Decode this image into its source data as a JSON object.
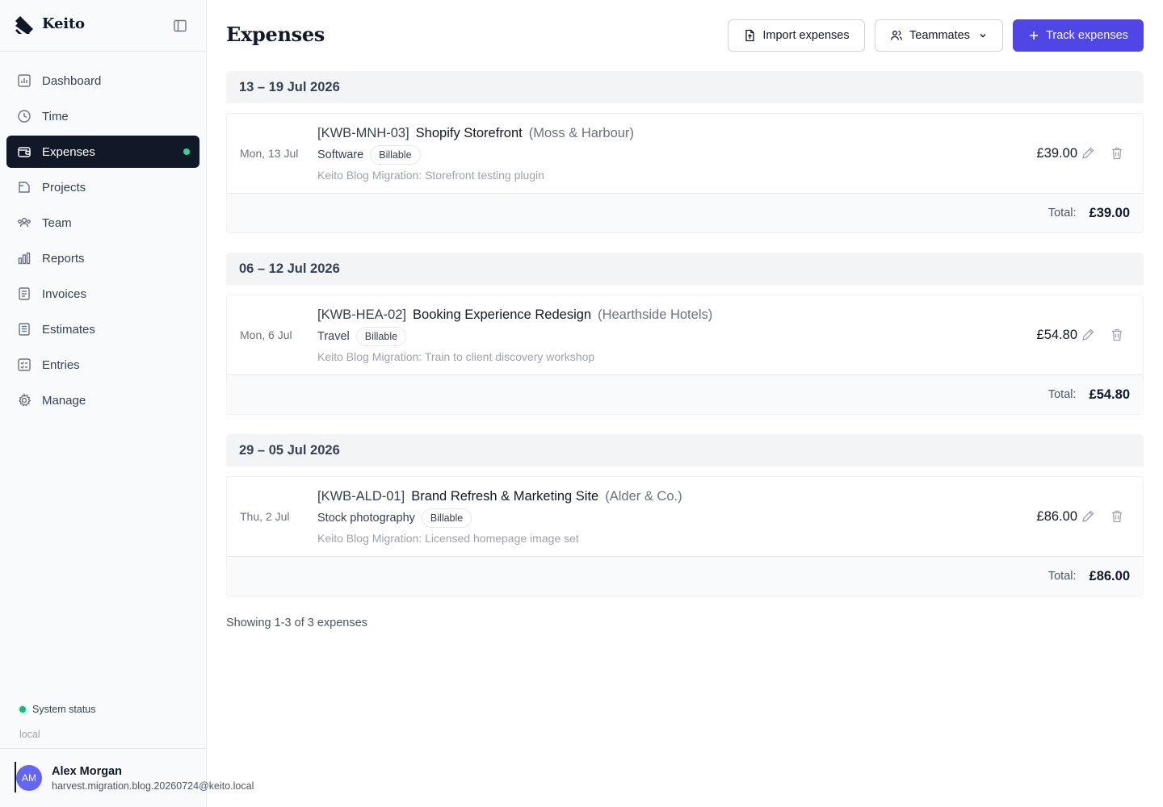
{
  "app": {
    "name": "Keito"
  },
  "sidebar": {
    "items": [
      {
        "label": "Dashboard",
        "icon": "dashboard-icon"
      },
      {
        "label": "Time",
        "icon": "clock-icon"
      },
      {
        "label": "Expenses",
        "icon": "wallet-icon",
        "active": true
      },
      {
        "label": "Projects",
        "icon": "folder-icon"
      },
      {
        "label": "Team",
        "icon": "users-icon"
      },
      {
        "label": "Reports",
        "icon": "bar-chart-icon"
      },
      {
        "label": "Invoices",
        "icon": "invoice-icon"
      },
      {
        "label": "Estimates",
        "icon": "estimate-icon"
      },
      {
        "label": "Entries",
        "icon": "checklist-icon"
      },
      {
        "label": "Manage",
        "icon": "gear-icon"
      }
    ],
    "status_label": "System status",
    "environment": "local"
  },
  "user": {
    "initials": "AM",
    "name": "Alex Morgan",
    "email": "harvest.migration.blog.20260724@keito.local"
  },
  "header": {
    "title": "Expenses",
    "import_label": "Import expenses",
    "teammates_label": "Teammates",
    "track_label": "Track expenses"
  },
  "groups": [
    {
      "range": "13 – 19 Jul 2026",
      "entries": [
        {
          "date": "Mon, 13 Jul",
          "code": "[KWB-MNH-03]",
          "project": "Shopify Storefront",
          "client": "(Moss & Harbour)",
          "category": "Software",
          "badge": "Billable",
          "notes": "Keito Blog Migration: Storefront testing plugin",
          "amount": "£39.00"
        }
      ],
      "total_label": "Total:",
      "total": "£39.00"
    },
    {
      "range": "06 – 12 Jul 2026",
      "entries": [
        {
          "date": "Mon, 6 Jul",
          "code": "[KWB-HEA-02]",
          "project": "Booking Experience Redesign",
          "client": "(Hearthside Hotels)",
          "category": "Travel",
          "badge": "Billable",
          "notes": "Keito Blog Migration: Train to client discovery workshop",
          "amount": "£54.80"
        }
      ],
      "total_label": "Total:",
      "total": "£54.80"
    },
    {
      "range": "29 – 05 Jul 2026",
      "entries": [
        {
          "date": "Thu, 2 Jul",
          "code": "[KWB-ALD-01]",
          "project": "Brand Refresh & Marketing Site",
          "client": "(Alder & Co.)",
          "category": "Stock photography",
          "badge": "Billable",
          "notes": "Keito Blog Migration: Licensed homepage image set",
          "amount": "£86.00"
        }
      ],
      "total_label": "Total:",
      "total": "£86.00"
    }
  ],
  "pagination": {
    "text": "Showing 1-3 of 3 expenses"
  },
  "colors": {
    "accent": "#4f46e5",
    "active_nav": "#111827",
    "status_ok": "#10b981",
    "avatar": "#6366f1"
  }
}
